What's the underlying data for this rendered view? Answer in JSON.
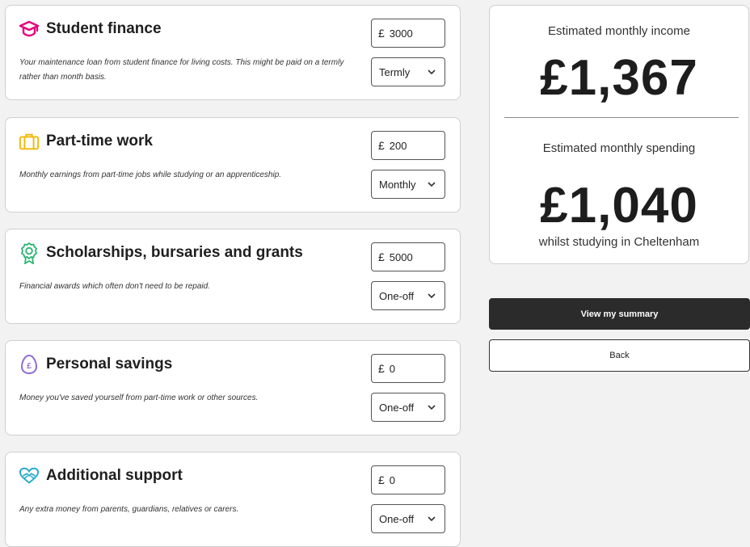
{
  "income_sources": [
    {
      "title": "Student finance",
      "icon": "graduation-cap-icon",
      "icon_color": "#e6007e",
      "description": "Your maintenance loan from student finance for living costs. This might be paid on a termly rather than month basis.",
      "currency": "£",
      "amount": "3000",
      "frequency": "Termly"
    },
    {
      "title": "Part-time work",
      "icon": "briefcase-icon",
      "icon_color": "#f2b705",
      "description": "Monthly earnings from part-time jobs while studying or an apprenticeship.",
      "currency": "£",
      "amount": "200",
      "frequency": "Monthly"
    },
    {
      "title": "Scholarships, bursaries and grants",
      "icon": "award-rosette-icon",
      "icon_color": "#2bb673",
      "description": "Financial awards which often don't need to be repaid.",
      "currency": "£",
      "amount": "5000",
      "frequency": "One-off"
    },
    {
      "title": "Personal savings",
      "icon": "savings-egg-icon",
      "icon_color": "#8e6bd8",
      "description": "Money you've saved yourself from part-time work or other sources.",
      "currency": "£",
      "amount": "0",
      "frequency": "One-off"
    },
    {
      "title": "Additional support",
      "icon": "heart-hands-icon",
      "icon_color": "#1fa8c9",
      "description": "Any extra money from parents, guardians, relatives or carers.",
      "currency": "£",
      "amount": "0",
      "frequency": "One-off"
    }
  ],
  "summary": {
    "income_label": "Estimated monthly income",
    "income_value": "£1,367",
    "spending_label": "Estimated monthly spending",
    "spending_value": "£1,040",
    "spending_note": "whilst studying in Cheltenham"
  },
  "actions": {
    "view_summary": "View my summary",
    "back": "Back"
  }
}
